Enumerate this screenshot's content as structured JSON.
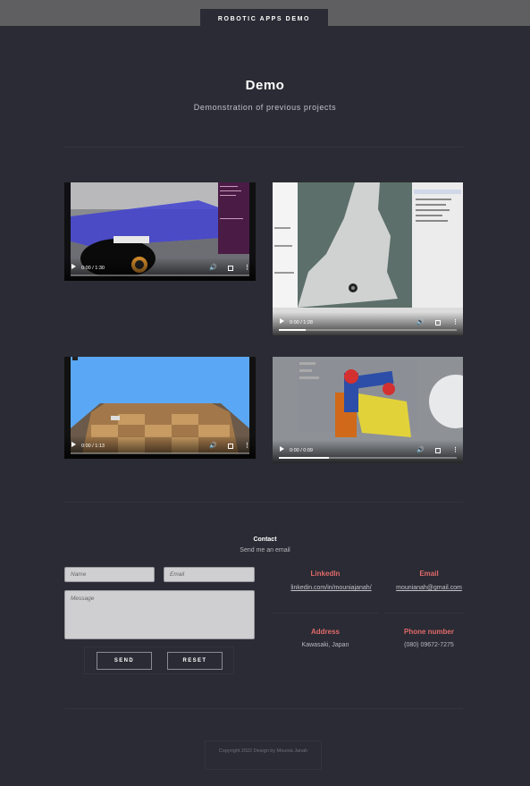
{
  "header": {
    "brand": "ROBOTIC APPS DEMO"
  },
  "hero": {
    "title": "Demo",
    "subtitle": "Demonstration of previous projects"
  },
  "videos": [
    {
      "time": "0:00 / 1:30",
      "progress": 0.0
    },
    {
      "time": "0:00 / 1:28",
      "progress": 0.15
    },
    {
      "time": "0:00 / 1:13",
      "progress": 0.0
    },
    {
      "time": "0:00 / 0:09",
      "progress": 0.28
    }
  ],
  "contact": {
    "title": "Contact",
    "subtitle": "Send me an email",
    "form": {
      "name_placeholder": "Name",
      "email_placeholder": "Email",
      "message_placeholder": "Message",
      "send_label": "SEND",
      "reset_label": "RESET"
    },
    "info": {
      "linkedin_label": "LinkedIn",
      "linkedin_value": "linkedin.com/in/mouniajanah/",
      "email_label": "Email",
      "email_value": "mounianah@gmail.com",
      "address_label": "Address",
      "address_value": "Kawasaki, Japan",
      "phone_label": "Phone number",
      "phone_value": "(080) 09672-7275"
    },
    "accent_color": "#e06a6a"
  },
  "footer": {
    "text": "Copyright 2022 Design by Mounia Janah"
  }
}
